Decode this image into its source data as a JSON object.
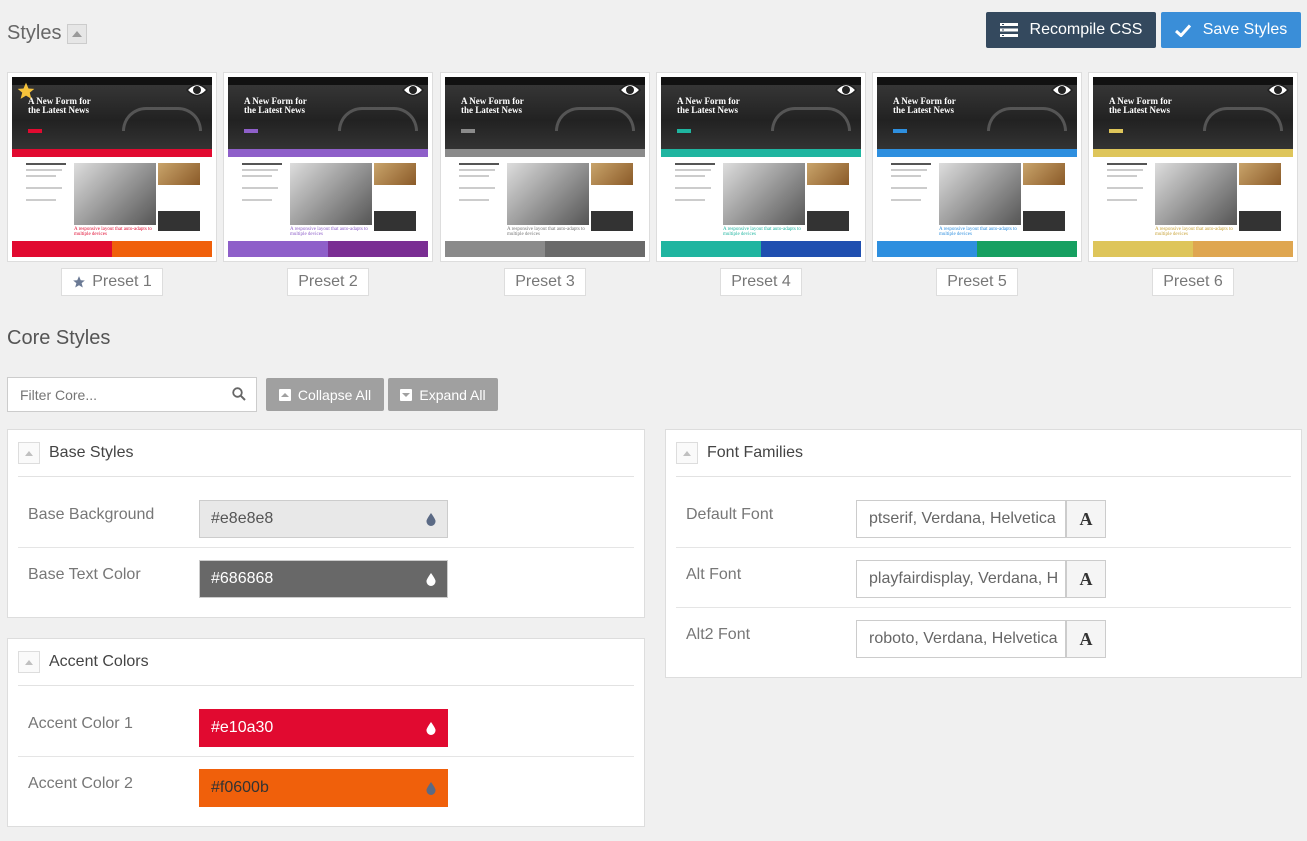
{
  "header": {
    "title": "Styles",
    "recompile_label": "Recompile CSS",
    "save_label": "Save Styles"
  },
  "presets": [
    {
      "label": "Preset 1",
      "active": true,
      "colors": [
        "#e10a30",
        "#f0600b"
      ]
    },
    {
      "label": "Preset 2",
      "active": false,
      "colors": [
        "#8e5fc9",
        "#7a2e93"
      ]
    },
    {
      "label": "Preset 3",
      "active": false,
      "colors": [
        "#8a8a8a",
        "#6a6a6a"
      ]
    },
    {
      "label": "Preset 4",
      "active": false,
      "colors": [
        "#1fb5a0",
        "#1f4fb0"
      ]
    },
    {
      "label": "Preset 5",
      "active": false,
      "colors": [
        "#2e8fdf",
        "#16a061"
      ]
    },
    {
      "label": "Preset 6",
      "active": false,
      "colors": [
        "#dec55a",
        "#dfa650"
      ]
    }
  ],
  "thumbnail": {
    "headline": "A New Form for the Latest News",
    "subline": "A responsive layout that auto-adapts to multiple devices"
  },
  "core": {
    "title": "Core Styles",
    "filter_placeholder": "Filter Core...",
    "collapse_all": "Collapse All",
    "expand_all": "Expand All"
  },
  "base_styles": {
    "title": "Base Styles",
    "rows": [
      {
        "label": "Base Background",
        "value": "#e8e8e8",
        "bg": "#e8e8e8",
        "fg": "#555555",
        "drop": "#5b6a85"
      },
      {
        "label": "Base Text Color",
        "value": "#686868",
        "bg": "#686868",
        "fg": "#ffffff",
        "drop": "#ffffff"
      }
    ]
  },
  "accent_colors": {
    "title": "Accent Colors",
    "rows": [
      {
        "label": "Accent Color 1",
        "value": "#e10a30",
        "bg": "#e10a30",
        "fg": "#ffffff",
        "drop": "#ffffff"
      },
      {
        "label": "Accent Color 2",
        "value": "#f0600b",
        "bg": "#f0600b",
        "fg": "#333333",
        "drop": "#5b6a85"
      }
    ]
  },
  "font_families": {
    "title": "Font Families",
    "rows": [
      {
        "label": "Default Font",
        "value": "ptserif, Verdana, Helvetica",
        "icon": "A"
      },
      {
        "label": "Alt Font",
        "value": "playfairdisplay, Verdana, H",
        "icon": "A"
      },
      {
        "label": "Alt2 Font",
        "value": "roboto, Verdana, Helvetica",
        "icon": "A"
      }
    ]
  }
}
